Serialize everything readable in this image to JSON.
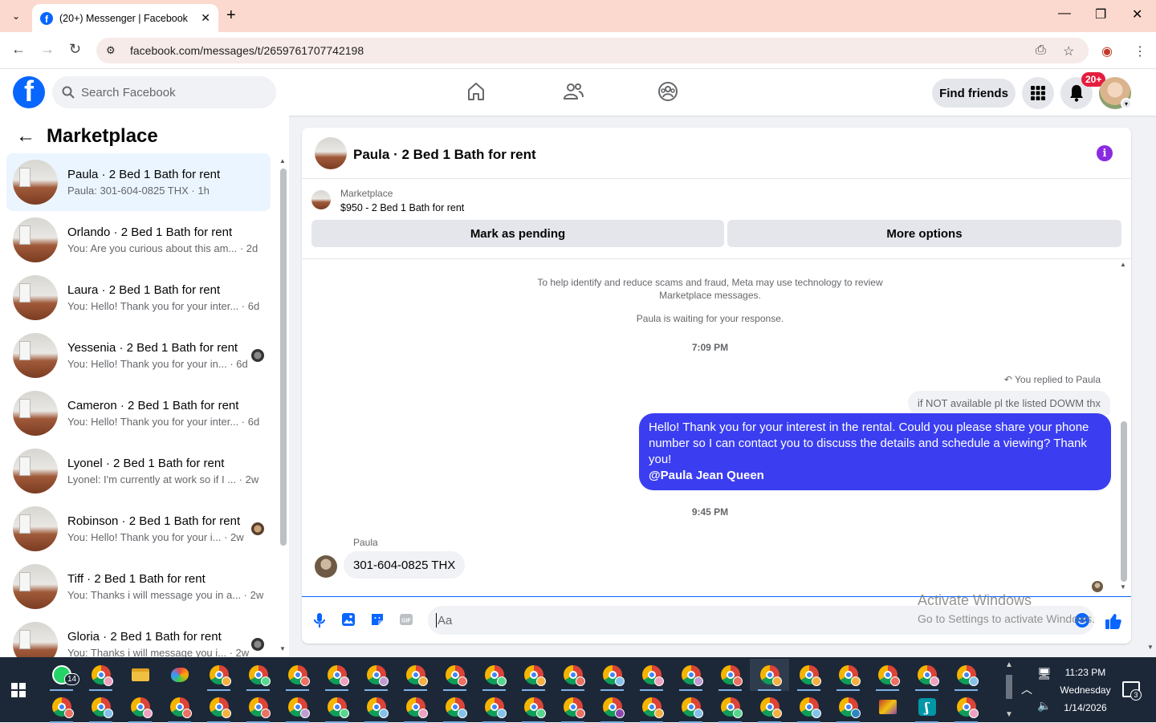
{
  "browser": {
    "tab_title": "(20+) Messenger | Facebook",
    "tab_favicon": "facebook-favicon-icon",
    "url": "facebook.com/messages/t/2659761707742198"
  },
  "fb_header": {
    "search_placeholder": "Search Facebook",
    "find_friends": "Find friends",
    "notification_badge": "20+"
  },
  "sidebar": {
    "title": "Marketplace",
    "conversations": [
      {
        "name": "Paula · 2 Bed 1 Bath for rent",
        "preview": "Paula: 301-604-0825 THX · 1h",
        "active": true
      },
      {
        "name": "Orlando · 2 Bed 1 Bath for rent",
        "preview": "You: Are you curious about this am... · 2d"
      },
      {
        "name": "Laura · 2 Bed 1 Bath for rent",
        "preview": "You: Hello! Thank you for your inter... · 6d"
      },
      {
        "name": "Yessenia · 2 Bed 1 Bath for rent",
        "preview": "You: Hello! Thank you for your in... · 6d",
        "seen": true
      },
      {
        "name": "Cameron · 2 Bed 1 Bath for rent",
        "preview": "You: Hello! Thank you for your inter... · 6d"
      },
      {
        "name": "Lyonel · 2 Bed 1 Bath for rent",
        "preview": "Lyonel: I'm currently at work so if I ... · 2w"
      },
      {
        "name": "Robinson · 2 Bed 1 Bath for rent",
        "preview": "You: Hello! Thank you for your i... · 2w",
        "seen": true
      },
      {
        "name": "Tiff · 2 Bed 1 Bath for rent",
        "preview": "You: Thanks i will message you in a... · 2w"
      },
      {
        "name": "Gloria · 2 Bed 1 Bath for rent",
        "preview": "You: Thanks i will message you i... · 2w",
        "seen": true
      }
    ]
  },
  "chat": {
    "title": "Paula · 2 Bed 1 Bath for rent",
    "marketplace_label": "Marketplace",
    "listing": "$950 - 2 Bed 1 Bath for rent",
    "mark_pending": "Mark as pending",
    "more_options": "More options",
    "system_note_1": "To help identify and reduce scams and fraud, Meta may use technology to review",
    "system_note_2": "Marketplace messages.",
    "waiting_note": "Paula is waiting for your response.",
    "time_1": "7:09 PM",
    "reply_note": "You replied to Paula",
    "quoted_text": "if NOT available pl tke listed DOWM thx",
    "outgoing_text": "Hello! Thank you for your interest in the rental. Could you please share your phone number so I can contact you to discuss the details and schedule a viewing? Thank you!",
    "outgoing_mention": "@Paula Jean Queen",
    "time_2": "9:45 PM",
    "incoming_sender": "Paula",
    "incoming_text": "301-604-0825 THX",
    "composer_placeholder": "Aa"
  },
  "watermark": {
    "line1": "Activate Windows",
    "line2": "Go to Settings to activate Windows."
  },
  "taskbar": {
    "whatsapp_badge": "14",
    "time": "11:23 PM",
    "day": "Wednesday",
    "date": "1/14/2026",
    "notification_count": "3"
  },
  "colors": {
    "fb_blue": "#0866ff",
    "outgoing_bubble": "#3b3ef0",
    "info_icon": "#8a2be2",
    "badge_red": "#e41e3f",
    "tab_strip": "#fcd9cf"
  }
}
